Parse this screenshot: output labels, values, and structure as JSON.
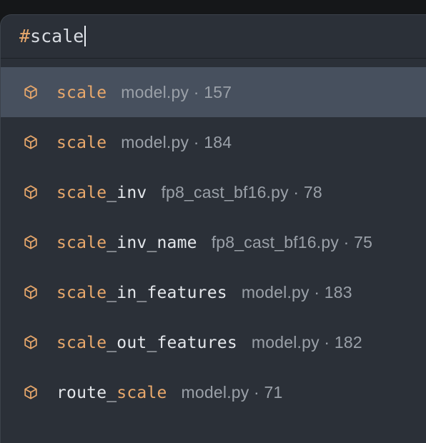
{
  "search": {
    "prefix": "#",
    "query": "scale"
  },
  "colors": {
    "match": "#e9a86b",
    "icon": "#e9a86b",
    "selected_row": "#47505e",
    "panel": "#2b3038"
  },
  "results": [
    {
      "icon": "cube-icon",
      "name_before": "",
      "name_match": "scale",
      "name_after": "",
      "meta": "model.py · 157",
      "selected": true
    },
    {
      "icon": "cube-icon",
      "name_before": "",
      "name_match": "scale",
      "name_after": "",
      "meta": "model.py · 184"
    },
    {
      "icon": "cube-icon",
      "name_before": "",
      "name_match": "scale",
      "name_after": "_inv",
      "meta": "fp8_cast_bf16.py · 78"
    },
    {
      "icon": "cube-icon",
      "name_before": "",
      "name_match": "scale",
      "name_after": "_inv_name",
      "meta": "fp8_cast_bf16.py · 75"
    },
    {
      "icon": "cube-icon",
      "name_before": "",
      "name_match": "scale",
      "name_after": "_in_features",
      "meta": "model.py · 183"
    },
    {
      "icon": "cube-icon",
      "name_before": "",
      "name_match": "scale",
      "name_after": "_out_features",
      "meta": "model.py · 182"
    },
    {
      "icon": "cube-icon",
      "name_before": "route_",
      "name_match": "scale",
      "name_after": "",
      "meta": "model.py · 71"
    }
  ]
}
